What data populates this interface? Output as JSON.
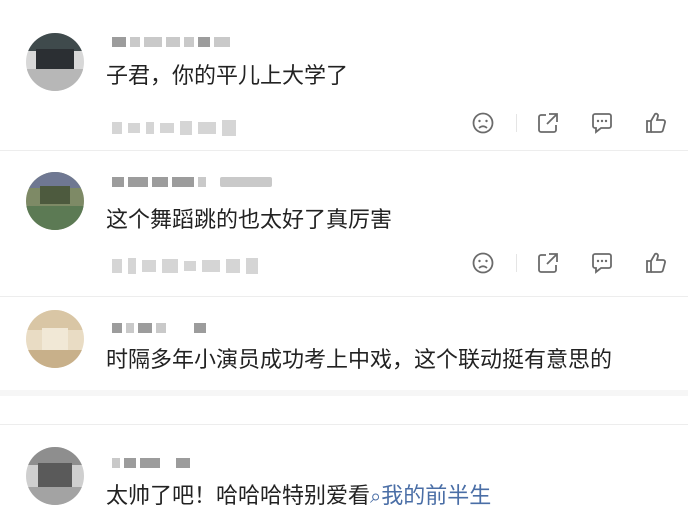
{
  "comments": [
    {
      "text": "子君，你的平儿上大学了"
    },
    {
      "text": "这个舞蹈跳的也太好了真厉害"
    },
    {
      "text": "时隔多年小演员成功考上中戏，这个联动挺有意思的"
    },
    {
      "text_prefix": "太帅了吧！哈哈哈特别爱看",
      "topic_link": "我的前半生"
    }
  ],
  "icons": [
    "dislike-icon",
    "share-icon",
    "comment-icon",
    "like-icon",
    "search-icon"
  ],
  "colors": {
    "link": "#4a6ea6",
    "icon": "#6b6b6b",
    "vip_badge": "#a9c7ef"
  }
}
